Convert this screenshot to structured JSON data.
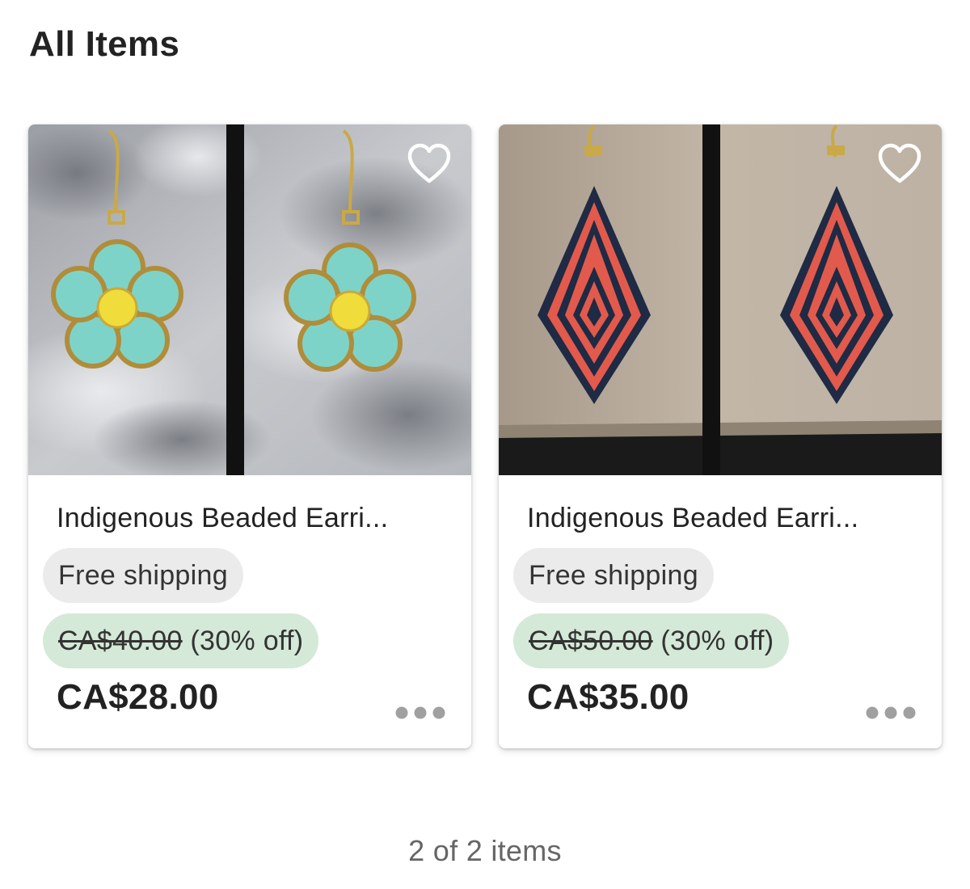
{
  "page": {
    "title": "All Items",
    "item_count": "2 of 2 items"
  },
  "items": [
    {
      "image_description_icon": "flower-beaded-earrings-photo",
      "title": "Indigenous Beaded Earri...",
      "shipping": "Free shipping",
      "original_price": "CA$40.00",
      "discount": "(30% off)",
      "price": "CA$28.00",
      "favorite_icon": "heart-outline-icon",
      "more_icon": "more-dots-icon"
    },
    {
      "image_description_icon": "diamond-beaded-earrings-photo",
      "title": "Indigenous Beaded Earri...",
      "shipping": "Free shipping",
      "original_price": "CA$50.00",
      "discount": "(30% off)",
      "price": "CA$35.00",
      "favorite_icon": "heart-outline-icon",
      "more_icon": "more-dots-icon"
    }
  ],
  "colors": {
    "text_primary": "#222222",
    "text_muted": "#666666",
    "shipping_badge_bg": "#ebebeb",
    "sale_badge_bg": "#d4e9d7",
    "more_dots": "#a0a0a0"
  }
}
